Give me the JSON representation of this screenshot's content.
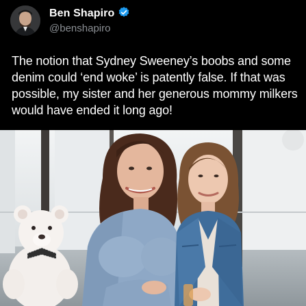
{
  "author": {
    "display_name": "Ben Shapiro",
    "handle": "@benshapiro",
    "verified": true,
    "verified_badge_color": "#1d9bf0"
  },
  "tweet": {
    "text": "The notion that Sydney Sweeney’s boobs and some denim could ‘end woke’ is patently false. If that was possible, my sister and her generous mommy milkers would have ended it long ago!"
  },
  "photo": {
    "icons": [
      "teddy-bear",
      "two-women"
    ]
  },
  "colors": {
    "background": "#000000",
    "text": "#ffffff",
    "handle": "#8b8f94"
  }
}
